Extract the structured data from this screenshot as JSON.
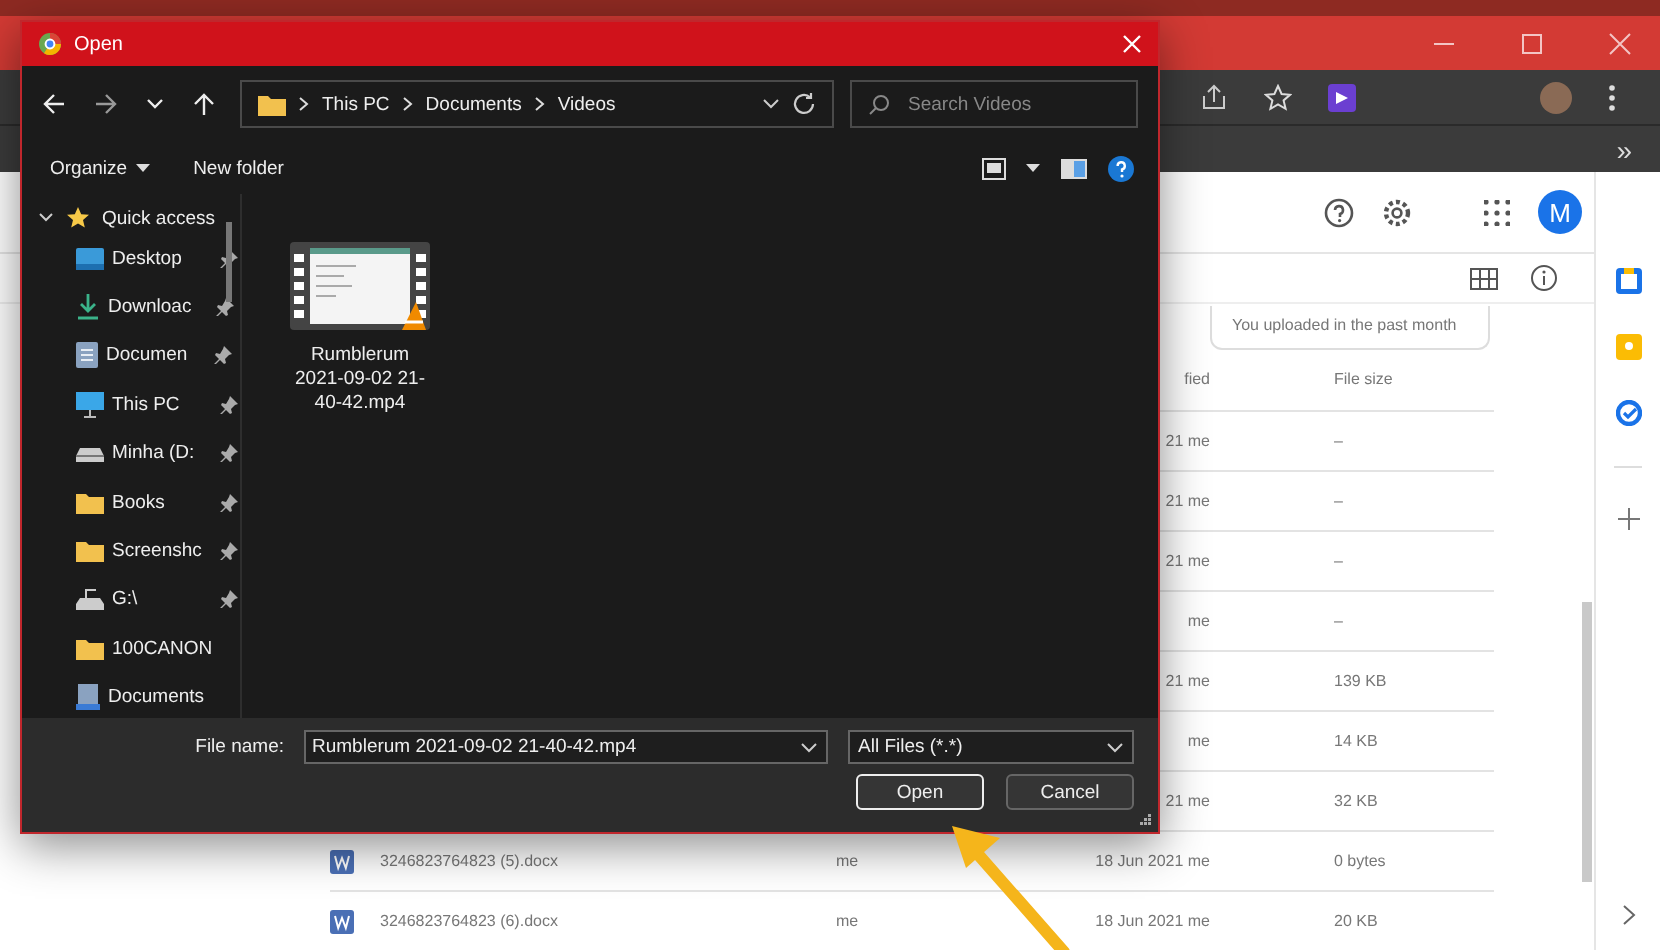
{
  "browser": {
    "bookmarks_overflow": "»"
  },
  "drive": {
    "avatar_letter": "M",
    "filter_chip": "You uploaded in the past month",
    "columns": [
      {
        "kind": "modified",
        "label": "fied"
      },
      {
        "kind": "size",
        "label": "File size"
      }
    ],
    "rows": [
      {
        "modified": "21 me",
        "size": "–"
      },
      {
        "modified": "21 me",
        "size": "–"
      },
      {
        "modified": "21 me",
        "size": "–"
      },
      {
        "modified": "me",
        "size": "–"
      },
      {
        "modified": "21 me",
        "size": "139 KB"
      },
      {
        "modified": "me",
        "size": "14 KB"
      },
      {
        "modified": "21 me",
        "size": "32 KB"
      },
      {
        "name": "3246823764823 (5).docx",
        "owner": "me",
        "modified": "18 Jun 2021 me",
        "size": "0 bytes"
      },
      {
        "name": "3246823764823 (6).docx",
        "owner": "me",
        "modified": "18 Jun 2021 me",
        "size": "20 KB"
      }
    ]
  },
  "dialog": {
    "title": "Open",
    "breadcrumb": [
      "This PC",
      "Documents",
      "Videos"
    ],
    "search": {
      "placeholder": "Search Videos"
    },
    "toolbar": {
      "organize": "Organize",
      "new_folder": "New folder"
    },
    "sidebar": {
      "items": [
        {
          "label": "Quick access",
          "kind": "star",
          "expanded": true,
          "children": [
            {
              "label": "Desktop",
              "kind": "desktop",
              "pinned": true
            },
            {
              "label": "Downloac",
              "kind": "download",
              "pinned": true
            },
            {
              "label": "Documen",
              "kind": "document",
              "pinned": true
            },
            {
              "label": "This PC",
              "kind": "pc",
              "pinned": true
            },
            {
              "label": "Minha (D:",
              "kind": "drive",
              "pinned": true
            },
            {
              "label": "Books",
              "kind": "folder",
              "pinned": true
            },
            {
              "label": "Screenshc",
              "kind": "folder",
              "pinned": true
            },
            {
              "label": "G:\\",
              "kind": "netdrive",
              "pinned": true
            },
            {
              "label": "100CANON",
              "kind": "folder",
              "pinned": false
            },
            {
              "label": "Documents",
              "kind": "library",
              "pinned": false
            }
          ]
        }
      ]
    },
    "files": [
      {
        "name": "Rumblerum 2021-09-02 21-40-42.mp4",
        "kind": "video"
      }
    ],
    "file_name": {
      "label": "File name:",
      "value": "Rumblerum 2021-09-02 21-40-42.mp4"
    },
    "file_type": {
      "value": "All Files (*.*)"
    },
    "buttons": [
      {
        "label": "Open",
        "selected": true
      },
      {
        "label": "Cancel",
        "selected": false
      }
    ]
  }
}
